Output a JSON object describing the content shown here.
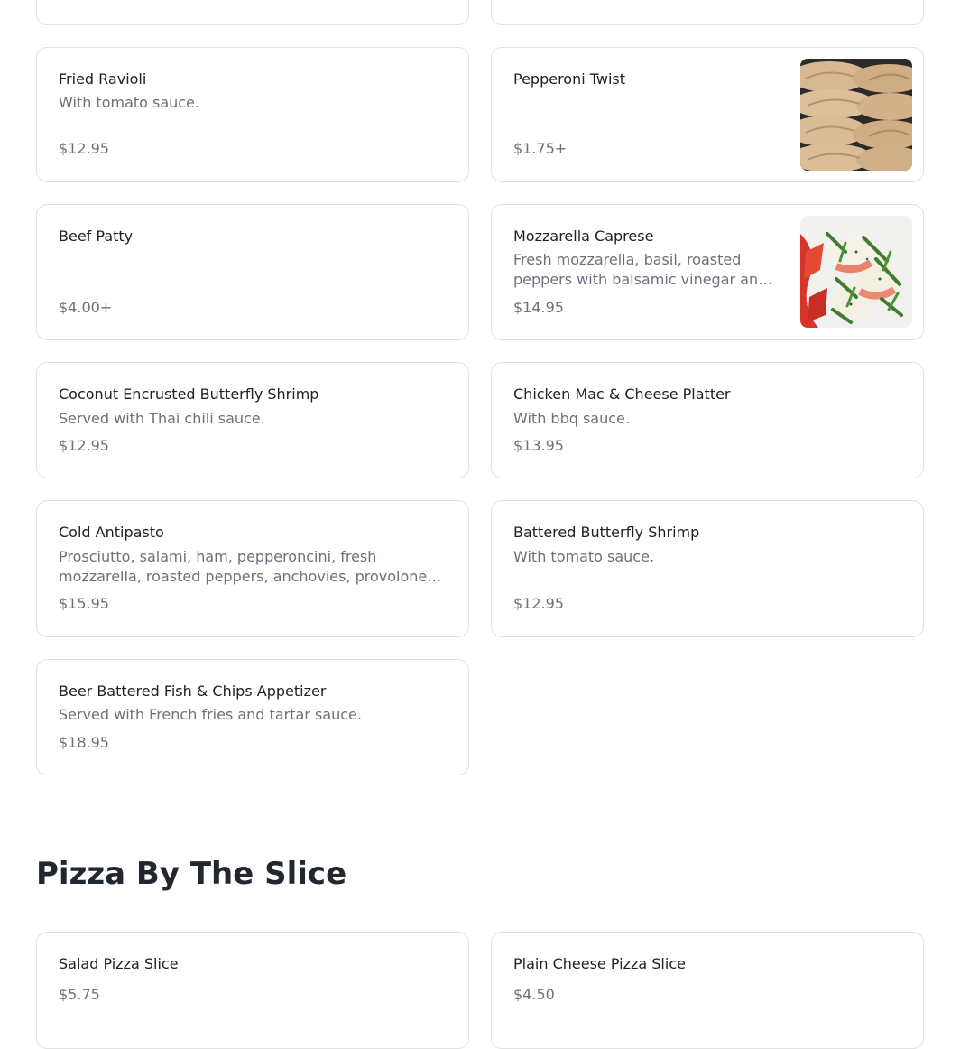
{
  "appetizers": [
    {
      "title": "Fried Ravioli",
      "description": "With tomato sauce.",
      "price": "$12.95"
    },
    {
      "title": "Pepperoni Twist",
      "description": "",
      "price": "$1.75+"
    },
    {
      "title": "Beef Patty",
      "description": "",
      "price": "$4.00+"
    },
    {
      "title": "Mozzarella Caprese",
      "description": "Fresh mozzarella, basil, roasted peppers with balsamic vinegar and olive oil.",
      "price": "$14.95"
    },
    {
      "title": "Coconut Encrusted Butterfly Shrimp",
      "description": "Served with Thai chili sauce.",
      "price": "$12.95"
    },
    {
      "title": "Chicken Mac & Cheese Platter",
      "description": "With bbq sauce.",
      "price": "$13.95"
    },
    {
      "title": "Cold Antipasto",
      "description": "Prosciutto, salami, ham, pepperoncini, fresh mozzarella, roasted peppers, anchovies, provolone cheese and olives.",
      "price": "$15.95"
    },
    {
      "title": "Battered Butterfly Shrimp",
      "description": "With tomato sauce.",
      "price": "$12.95"
    },
    {
      "title": "Beer Battered Fish & Chips Appetizer",
      "description": "Served with French fries and tartar sauce.",
      "price": "$18.95"
    }
  ],
  "pizza_section": {
    "heading": "Pizza By The Slice",
    "items": [
      {
        "title": "Salad Pizza Slice",
        "price": "$5.75"
      },
      {
        "title": "Plain Cheese Pizza Slice",
        "price": "$4.50"
      }
    ]
  },
  "images": {
    "pepperoni_twist": "pepperoni-twist-photo",
    "mozzarella_caprese": "mozzarella-caprese-photo"
  }
}
